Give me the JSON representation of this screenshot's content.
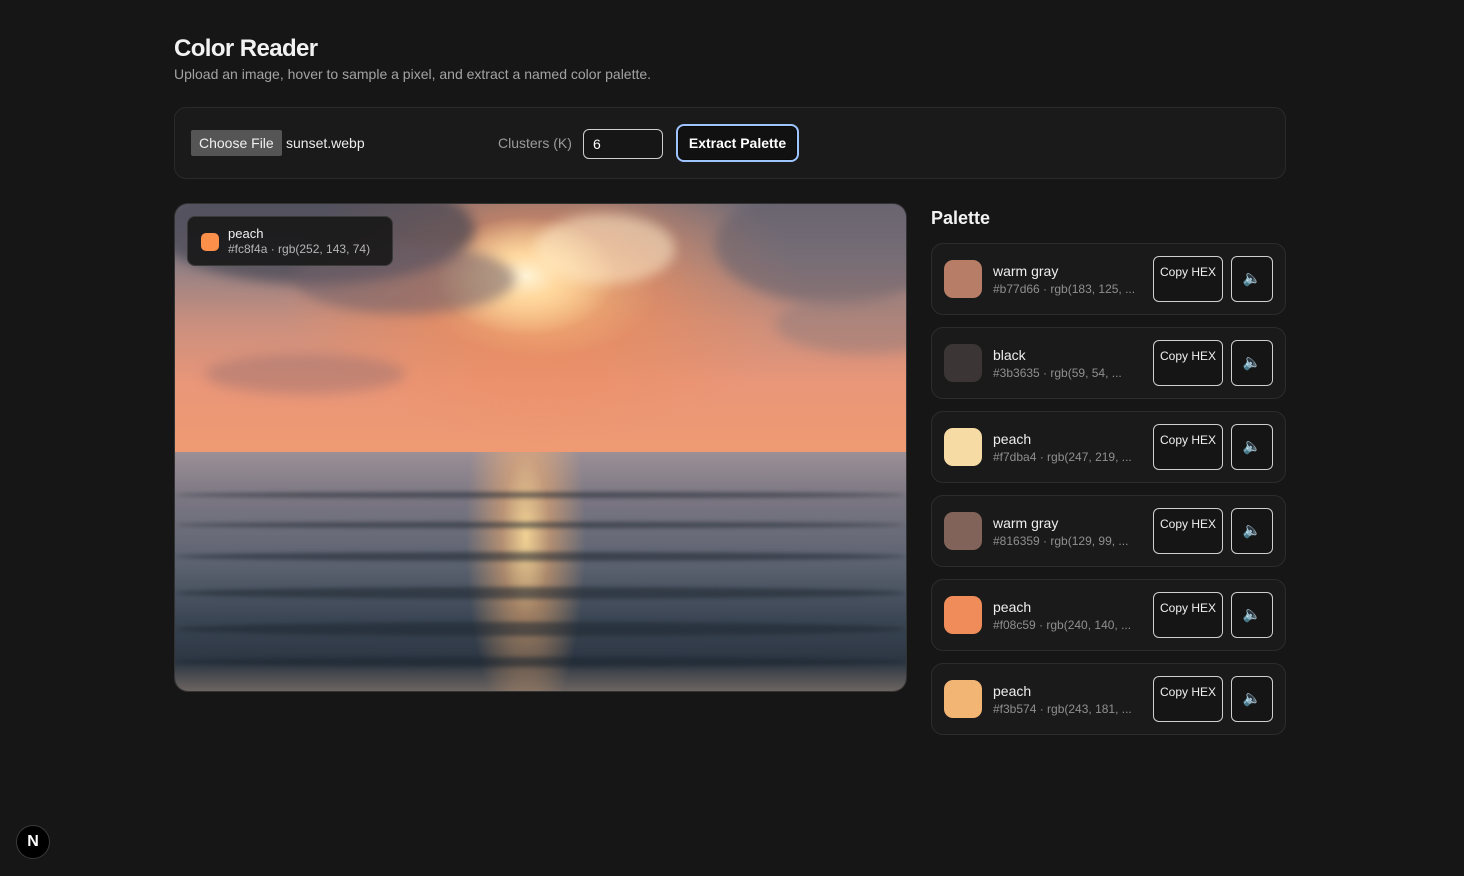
{
  "header": {
    "title": "Color Reader",
    "subtitle": "Upload an image, hover to sample a pixel, and extract a named color palette."
  },
  "controls": {
    "file_button": "Choose File",
    "file_name": "sunset.webp",
    "clusters_label": "Clusters (K)",
    "clusters_value": "6",
    "extract_button": "Extract Palette"
  },
  "sample": {
    "name": "peach",
    "meta": "#fc8f4a · rgb(252, 143, 74)",
    "color": "#fc8f4a"
  },
  "palette": {
    "title": "Palette",
    "copy_label": "Copy HEX",
    "speak_icon": "speaker-icon",
    "items": [
      {
        "name": "warm gray",
        "meta": "#b77d66 · rgb(183, 125, ...",
        "color": "#b77d66"
      },
      {
        "name": "black",
        "meta": "#3b3635 · rgb(59, 54, ...",
        "color": "#3b3635"
      },
      {
        "name": "peach",
        "meta": "#f7dba4 · rgb(247, 219, ...",
        "color": "#f7dba4"
      },
      {
        "name": "warm gray",
        "meta": "#816359 · rgb(129, 99, ...",
        "color": "#816359"
      },
      {
        "name": "peach",
        "meta": "#f08c59 · rgb(240, 140, ...",
        "color": "#f08c59"
      },
      {
        "name": "peach",
        "meta": "#f3b574 · rgb(243, 181, ...",
        "color": "#f3b574"
      }
    ]
  },
  "badge": {
    "letter": "N"
  }
}
